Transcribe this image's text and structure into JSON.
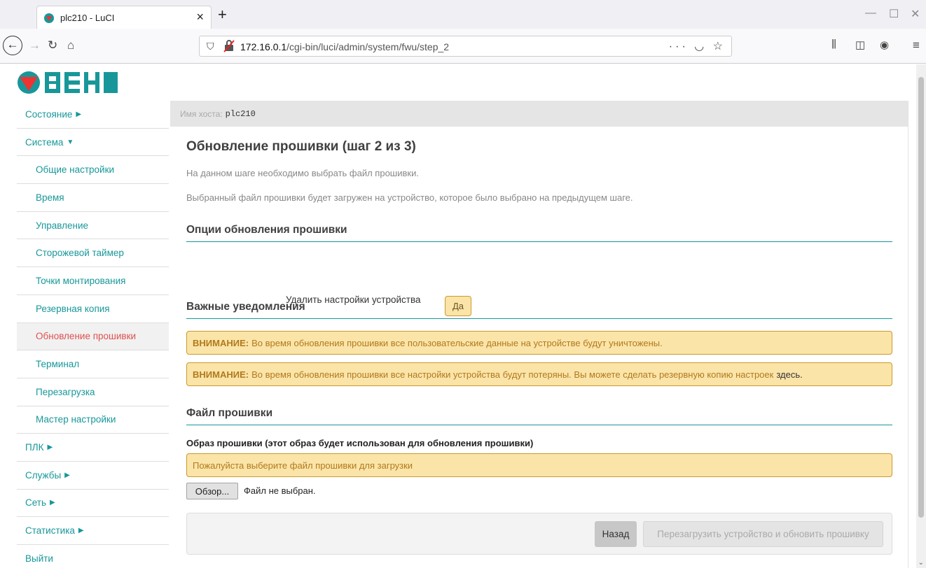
{
  "browser": {
    "tab_title": "plc210 - LuCI",
    "url_host": "172.16.0.1",
    "url_path": "/cgi-bin/luci/admin/system/fwu/step_2"
  },
  "header": {
    "logo_text": "ОВЕН"
  },
  "sidebar": {
    "items": [
      {
        "label": "Состояние",
        "arrow": "▶"
      },
      {
        "label": "Система",
        "arrow": "▼"
      },
      {
        "label": "Общие настройки"
      },
      {
        "label": "Время"
      },
      {
        "label": "Управление"
      },
      {
        "label": "Сторожевой таймер"
      },
      {
        "label": "Точки монтирования"
      },
      {
        "label": "Резервная копия"
      },
      {
        "label": "Обновление прошивки"
      },
      {
        "label": "Терминал"
      },
      {
        "label": "Перезагрузка"
      },
      {
        "label": "Мастер настройки"
      },
      {
        "label": "ПЛК",
        "arrow": "▶"
      },
      {
        "label": "Службы",
        "arrow": "▶"
      },
      {
        "label": "Сеть",
        "arrow": "▶"
      },
      {
        "label": "Статистика",
        "arrow": "▶"
      },
      {
        "label": "Выйти"
      }
    ]
  },
  "hostbar": {
    "label": "Имя хоста:",
    "value": "plc210"
  },
  "content": {
    "title": "Обновление прошивки (шаг 2 из 3)",
    "desc1": "На данном шаге необходимо выбрать файл прошивки.",
    "desc2": "Выбранный файл прошивки будет загружен на устройство, которое было выбрано на предыдущем шаге.",
    "options_heading": "Опции обновления прошивки",
    "option_label": "Удалить настройки устройства",
    "option_value": "Да",
    "notices_heading": "Важные уведомления",
    "warn_prefix": "ВНИМАНИЕ:",
    "warn1": "Во время обновления прошивки все пользовательские данные на устройстве будут уничтожены.",
    "warn2": "Во время обновления прошивки все настройки устройства будут потеряны. Вы можете сделать резервную копию настроек",
    "warn2_link": "здесь",
    "warn2_end": ".",
    "file_heading": "Файл прошивки",
    "file_label": "Образ прошивки (этот образ будет использован для обновления прошивки)",
    "file_hint": "Пожалуйста выберите файл прошивки для загрузки",
    "browse_label": "Обзор...",
    "no_file": "Файл не выбран.",
    "back_label": "Назад",
    "reboot_label": "Перезагрузить устройство и обновить прошивку"
  }
}
